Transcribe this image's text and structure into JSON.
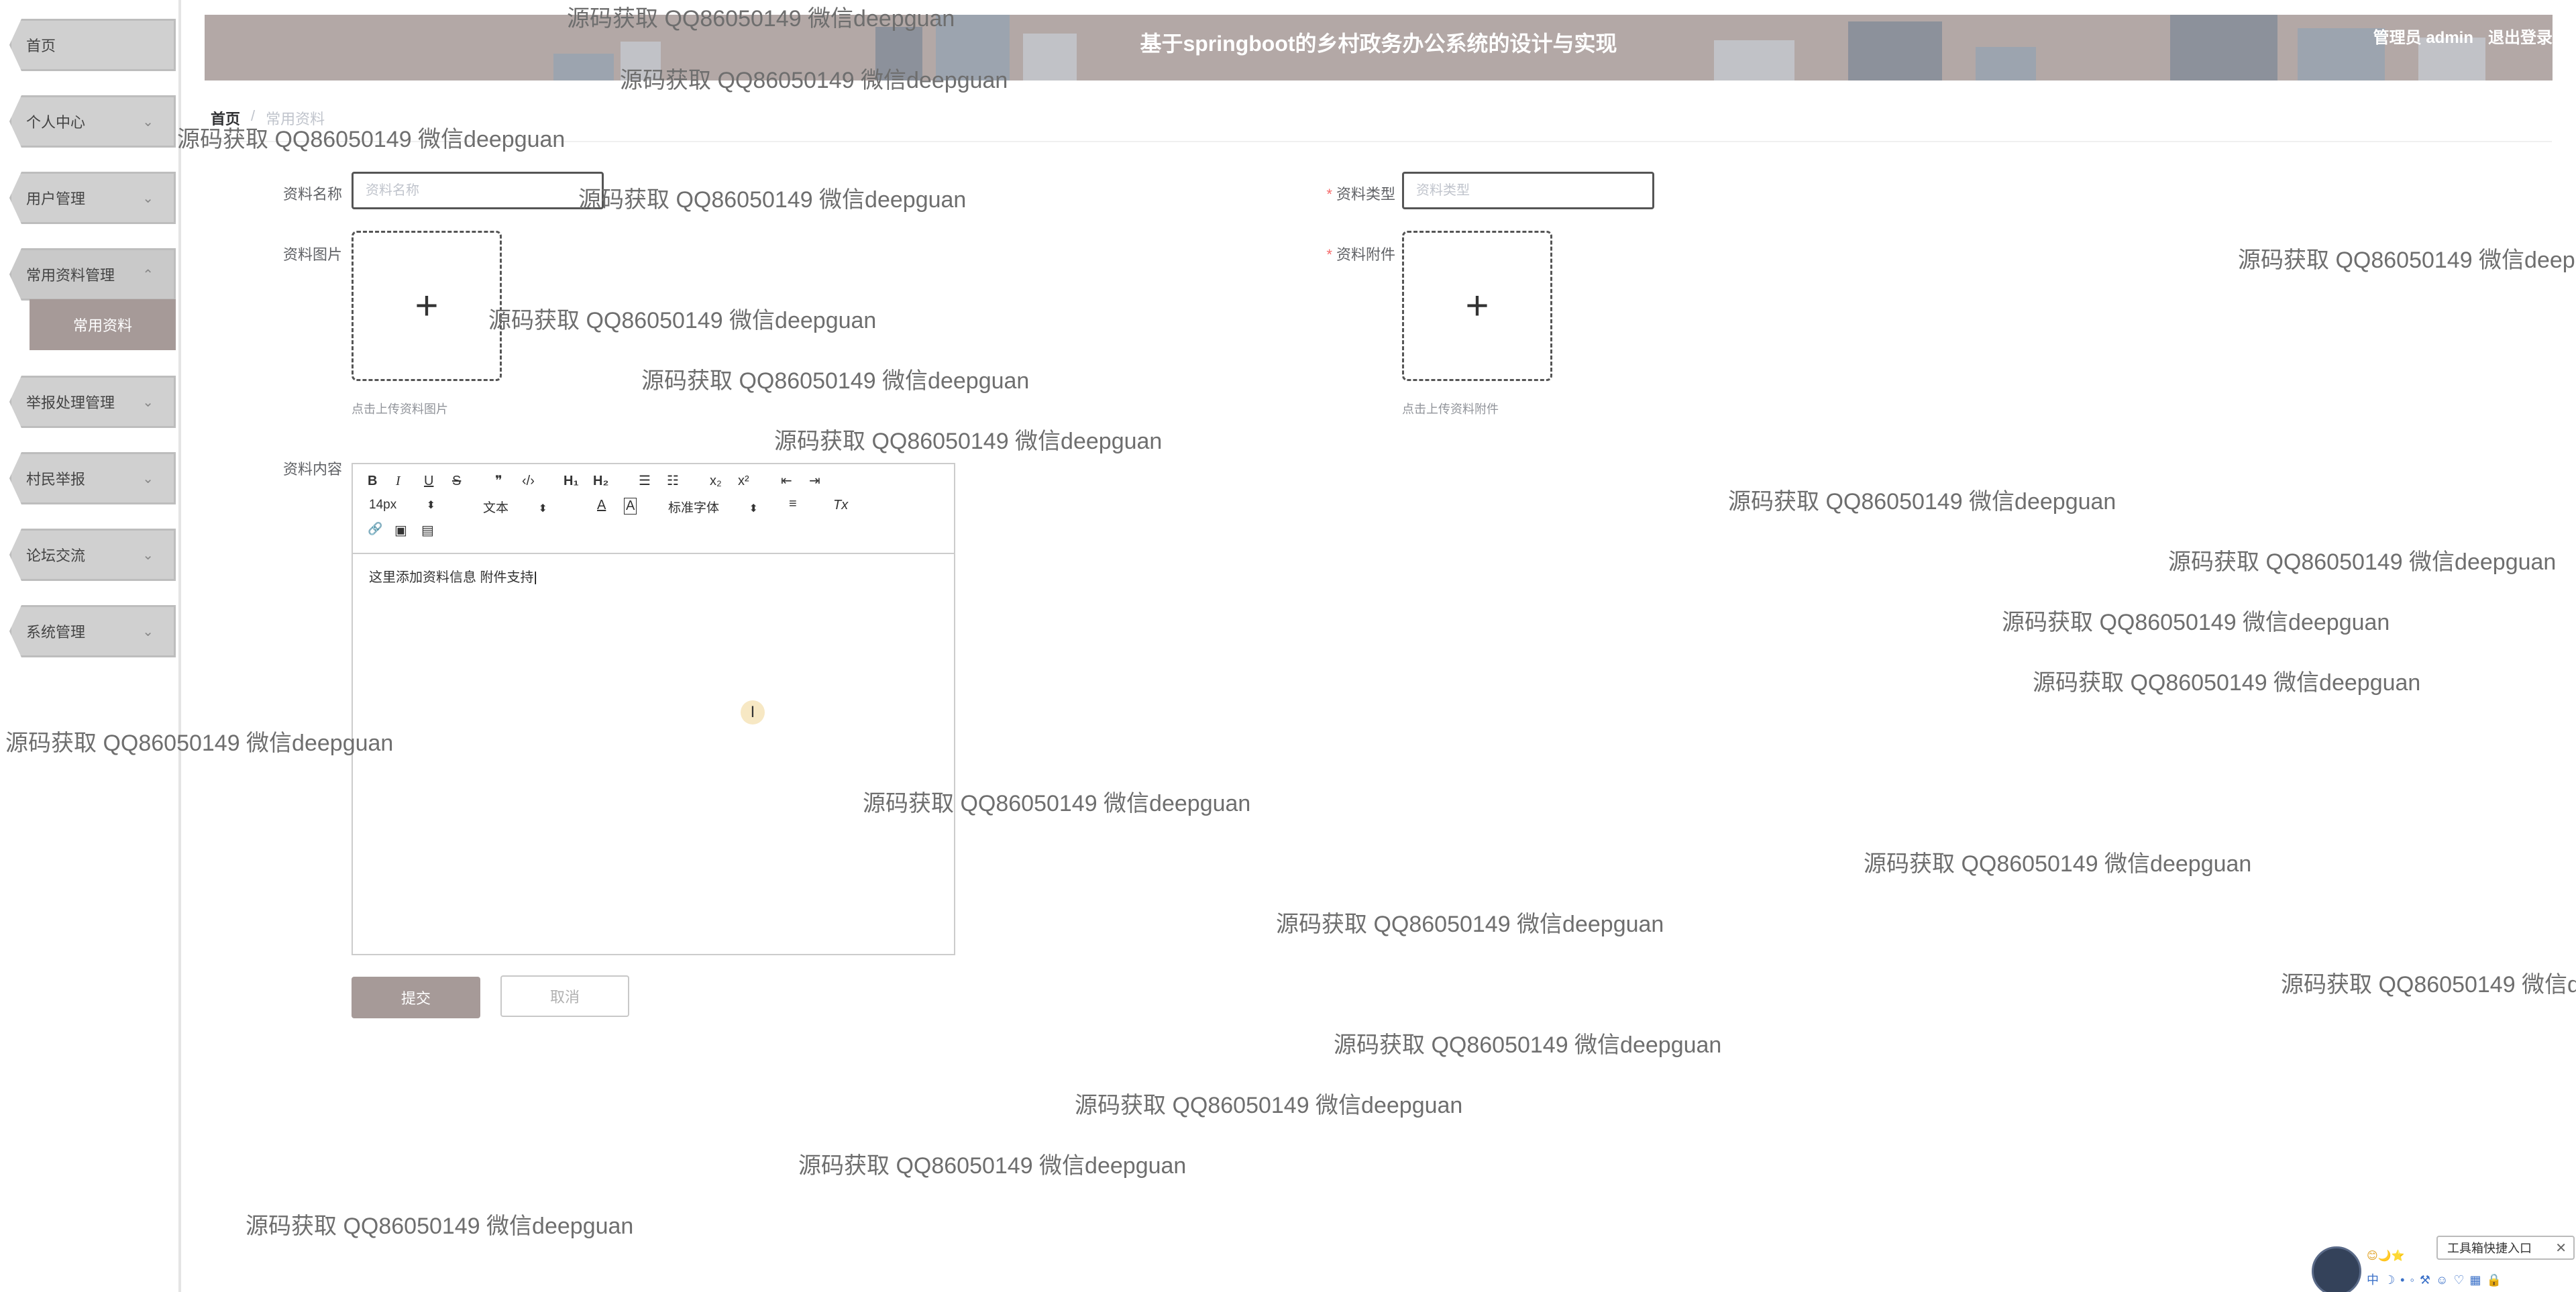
{
  "sidebar": {
    "items": [
      {
        "label": "首页",
        "arrow": ""
      },
      {
        "label": "个人中心",
        "arrow": "⌄"
      },
      {
        "label": "用户管理",
        "arrow": "⌄"
      },
      {
        "label": "常用资料管理",
        "arrow": "⌃"
      },
      {
        "label": "举报处理管理",
        "arrow": "⌄"
      },
      {
        "label": "村民举报",
        "arrow": "⌄"
      },
      {
        "label": "论坛交流",
        "arrow": "⌄"
      },
      {
        "label": "系统管理",
        "arrow": "⌄"
      }
    ],
    "active_sub_item": "常用资料"
  },
  "header": {
    "title": "基于springboot的乡村政务办公系统的设计与实现",
    "user": "管理员 admin",
    "logout": "退出登录"
  },
  "breadcrumb": {
    "home": "首页",
    "separator": "/",
    "current": "常用资料"
  },
  "form": {
    "name_label": "资料名称",
    "name_placeholder": "资料名称",
    "name_value": "",
    "type_label": "资料类型",
    "type_placeholder": "资料类型",
    "type_value": "",
    "required_mark": "*",
    "image_label": "资料图片",
    "image_tip": "点击上传资料图片",
    "file_label": "资料附件",
    "file_tip": "点击上传资料附件",
    "content_label": "资料内容",
    "content_value": "这里添加资料信息 附件支持",
    "submit": "提交",
    "cancel": "取消"
  },
  "editor_toolbar": {
    "bold": "B",
    "italic": "I",
    "underline": "U",
    "strike": "S",
    "quote": "❞",
    "code": "‹/›",
    "h1": "H₁",
    "h2": "H₂",
    "ordered_list": "☰",
    "bullet_list": "☷",
    "subscript": "x₂",
    "superscript": "x²",
    "outdent": "⇤",
    "indent": "⇥",
    "size": "14px",
    "header_select": "文本",
    "font_color": "A",
    "bg_color": "A",
    "font_select": "标准字体",
    "align": "≡",
    "clean": "Tx",
    "link": "🔗",
    "image": "▣",
    "video": "▤"
  },
  "watermark_text": "源码获取 QQ86050149 微信deepguan",
  "widget": {
    "tag": "工具箱快捷入口",
    "close": "✕",
    "emojis": "😊🌙⭐",
    "tools": "中☽•◦⚒☺♡▦🔒"
  },
  "colors": {
    "header_bg": "#b3a8a6",
    "accent": "#a69a98",
    "nav_bg": "#d0d0d0"
  }
}
